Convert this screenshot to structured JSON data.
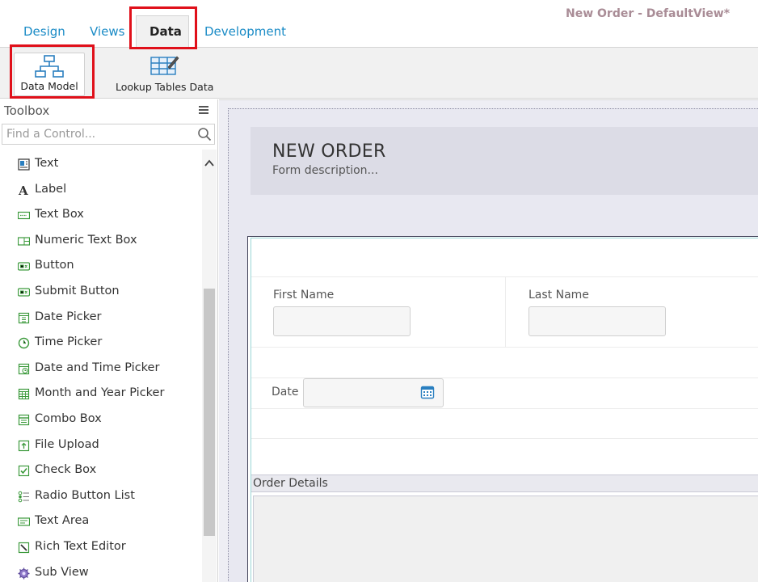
{
  "window": {
    "title": "New Order - DefaultView*"
  },
  "tabs": [
    {
      "label": "Design"
    },
    {
      "label": "Views"
    },
    {
      "label": "Data"
    },
    {
      "label": "Development"
    }
  ],
  "ribbon": {
    "data_model_label": "Data Model",
    "lookup_label": "Lookup Tables Data"
  },
  "toolbox": {
    "title": "Toolbox",
    "search_placeholder": "Find a Control...",
    "items": [
      {
        "label": "Text",
        "icon": "text-control-icon"
      },
      {
        "label": "Label",
        "icon": "label-icon"
      },
      {
        "label": "Text Box",
        "icon": "text-box-icon"
      },
      {
        "label": "Numeric Text Box",
        "icon": "numeric-text-box-icon"
      },
      {
        "label": "Button",
        "icon": "button-icon"
      },
      {
        "label": "Submit Button",
        "icon": "submit-button-icon"
      },
      {
        "label": "Date Picker",
        "icon": "date-picker-icon"
      },
      {
        "label": "Time Picker",
        "icon": "time-picker-icon"
      },
      {
        "label": "Date and Time Picker",
        "icon": "date-time-picker-icon"
      },
      {
        "label": "Month and Year Picker",
        "icon": "month-year-picker-icon"
      },
      {
        "label": "Combo Box",
        "icon": "combo-box-icon"
      },
      {
        "label": "File Upload",
        "icon": "file-upload-icon"
      },
      {
        "label": "Check Box",
        "icon": "check-box-icon"
      },
      {
        "label": "Radio Button List",
        "icon": "radio-button-list-icon"
      },
      {
        "label": "Text Area",
        "icon": "text-area-icon"
      },
      {
        "label": "Rich Text Editor",
        "icon": "rich-text-editor-icon"
      },
      {
        "label": "Sub View",
        "icon": "sub-view-icon"
      }
    ]
  },
  "form": {
    "title": "NEW ORDER",
    "description": "Form description...",
    "first_name_label": "First Name",
    "last_name_label": "Last Name",
    "date_label": "Date",
    "first_name_value": "",
    "last_name_value": "",
    "date_value": "",
    "order_details_label": "Order Details"
  },
  "colors": {
    "accent": "#1a8bc6",
    "highlight": "#e0101a",
    "icon_green": "#3c9a3c",
    "icon_blue": "#2a7fc0"
  }
}
